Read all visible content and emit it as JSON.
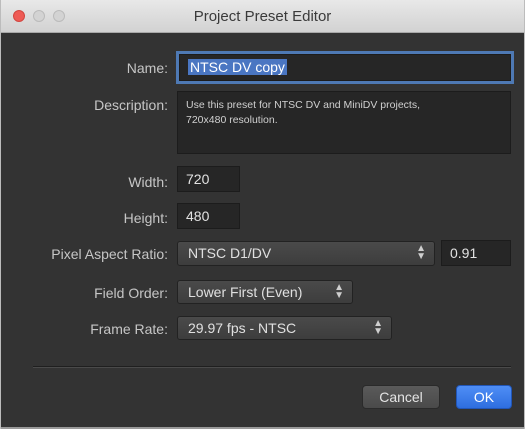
{
  "window": {
    "title": "Project Preset Editor"
  },
  "form": {
    "name_label": "Name:",
    "name_value": "NTSC DV copy",
    "description_label": "Description:",
    "description_line1": "Use this preset for NTSC DV and MiniDV projects,",
    "description_line2": "720x480 resolution.",
    "width_label": "Width:",
    "width_value": "720",
    "height_label": "Height:",
    "height_value": "480",
    "par_label": "Pixel Aspect Ratio:",
    "par_value": "NTSC D1/DV",
    "par_number": "0.91",
    "field_order_label": "Field Order:",
    "field_order_value": "Lower First (Even)",
    "frame_rate_label": "Frame Rate:",
    "frame_rate_value": "29.97 fps - NTSC"
  },
  "buttons": {
    "cancel": "Cancel",
    "ok": "OK"
  },
  "colors": {
    "accent": "#3a7bea",
    "close_button": "#ee5b55"
  },
  "icons": {
    "popup_arrows": "up-down-chevron-icon"
  }
}
